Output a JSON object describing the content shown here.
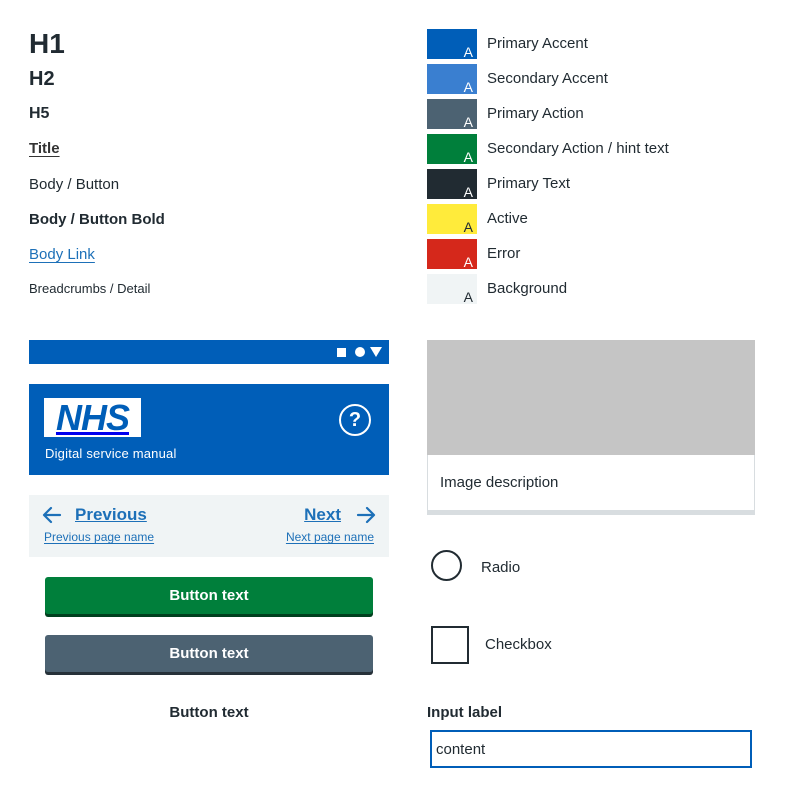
{
  "typography": {
    "h1": "H1",
    "h2": "H2",
    "h5": "H5",
    "title": "Title",
    "body": "Body / Button",
    "body_bold": "Body / Button Bold",
    "body_link": "Body Link",
    "breadcrumbs": "Breadcrumbs / Detail"
  },
  "swatches": [
    {
      "label": "Primary Accent",
      "color": "#005eb8",
      "letter": "A",
      "letter_color": "#ffffff"
    },
    {
      "label": "Secondary Accent",
      "color": "#3a7fd0",
      "letter": "A",
      "letter_color": "#ffffff"
    },
    {
      "label": "Primary Action",
      "color": "#4c6272",
      "letter": "A",
      "letter_color": "#ffffff"
    },
    {
      "label": "Secondary Action / hint text",
      "color": "#007f3b",
      "letter": "A",
      "letter_color": "#ffffff"
    },
    {
      "label": "Primary Text",
      "color": "#212b32",
      "letter": "A",
      "letter_color": "#ffffff"
    },
    {
      "label": "Active",
      "color": "#ffeb3b",
      "letter": "A",
      "letter_color": "#212b32"
    },
    {
      "label": "Error",
      "color": "#d5281b",
      "letter": "A",
      "letter_color": "#ffffff"
    },
    {
      "label": "Background",
      "color": "#f0f4f5",
      "letter": "A",
      "letter_color": "#212b32"
    }
  ],
  "status_bar": {
    "icons": [
      "square-icon",
      "circle-icon",
      "triangle-icon"
    ]
  },
  "header": {
    "logo_text": "NHS",
    "service_name": "Digital service manual",
    "help_glyph": "?"
  },
  "pagination": {
    "previous_label": "Previous",
    "previous_page_name": "Previous page name",
    "next_label": "Next",
    "next_page_name": "Next page name"
  },
  "buttons": {
    "primary_label": "Button text",
    "secondary_label": "Button text",
    "text_label": "Button text"
  },
  "card": {
    "description": "Image description"
  },
  "form": {
    "radio_label": "Radio",
    "checkbox_label": "Checkbox",
    "input_label": "Input label",
    "input_value": "content"
  },
  "colors": {
    "brand_blue": "#005eb8",
    "link_blue": "#1d70b8",
    "button_green": "#007f3b",
    "button_grey": "#4c6272",
    "pager_bg": "#f0f4f5",
    "image_placeholder": "#c5c5c5"
  }
}
